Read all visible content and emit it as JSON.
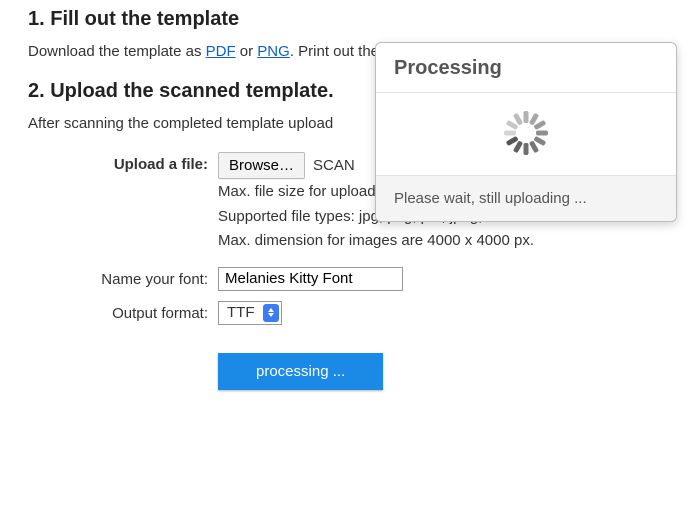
{
  "step1": {
    "heading": "1. Fill out the template",
    "text_prefix": "Download the template as ",
    "link_pdf": "PDF",
    "text_or": " or ",
    "link_png": "PNG",
    "text_suffix": ". Print out the template. Use any program to fill it out."
  },
  "step2": {
    "heading": "2. Upload the scanned template.",
    "text": "After scanning the completed template upload"
  },
  "upload": {
    "label": "Upload a file:",
    "browse": "Browse…",
    "filename": "SCAN",
    "hint1": "Max. file size for upload is 6 MB.",
    "hint2": "Supported file types: jpg, png, pdf, jpeg, tiff.",
    "hint3": "Max. dimension for images are 4000 x 4000 px."
  },
  "name": {
    "label": "Name your font:",
    "value": "Melanies Kitty Font"
  },
  "output": {
    "label": "Output format:",
    "value": "TTF"
  },
  "submit": {
    "label": "processing ..."
  },
  "modal": {
    "title": "Processing",
    "foot": "Please wait, still uploading ..."
  }
}
